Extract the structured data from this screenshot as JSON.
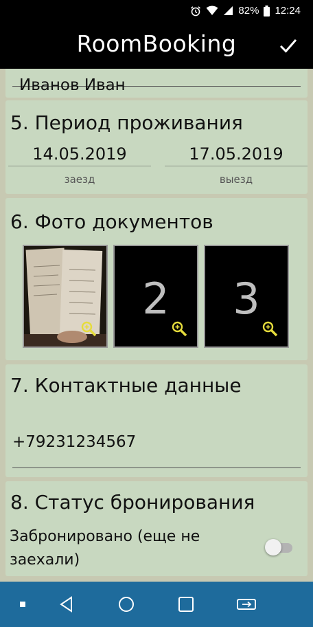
{
  "status_bar": {
    "battery": "82%",
    "time": "12:24"
  },
  "app_bar": {
    "title": "RoomBooking",
    "confirm_icon": "check-icon"
  },
  "guest": {
    "name": "Иванов Иван"
  },
  "period": {
    "heading": "5. Период проживания",
    "checkin_date": "14.05.2019",
    "checkin_label": "заезд",
    "checkout_date": "17.05.2019",
    "checkout_label": "выезд"
  },
  "photos": {
    "heading": "6. Фото документов",
    "slots": [
      {
        "label": "",
        "state": "photo"
      },
      {
        "label": "2",
        "state": "empty"
      },
      {
        "label": "3",
        "state": "empty"
      }
    ]
  },
  "contacts": {
    "heading": "7. Контактные данные",
    "phone": "+79231234567"
  },
  "booking_status": {
    "heading": "8. Статус бронирования",
    "label": "Забронировано (еще не заехали)",
    "enabled": false
  },
  "colors": {
    "card": "#c8d8c0",
    "background": "#c7c9b2",
    "navbar": "#1e6b9c",
    "zoom": "#e6dc3c"
  }
}
